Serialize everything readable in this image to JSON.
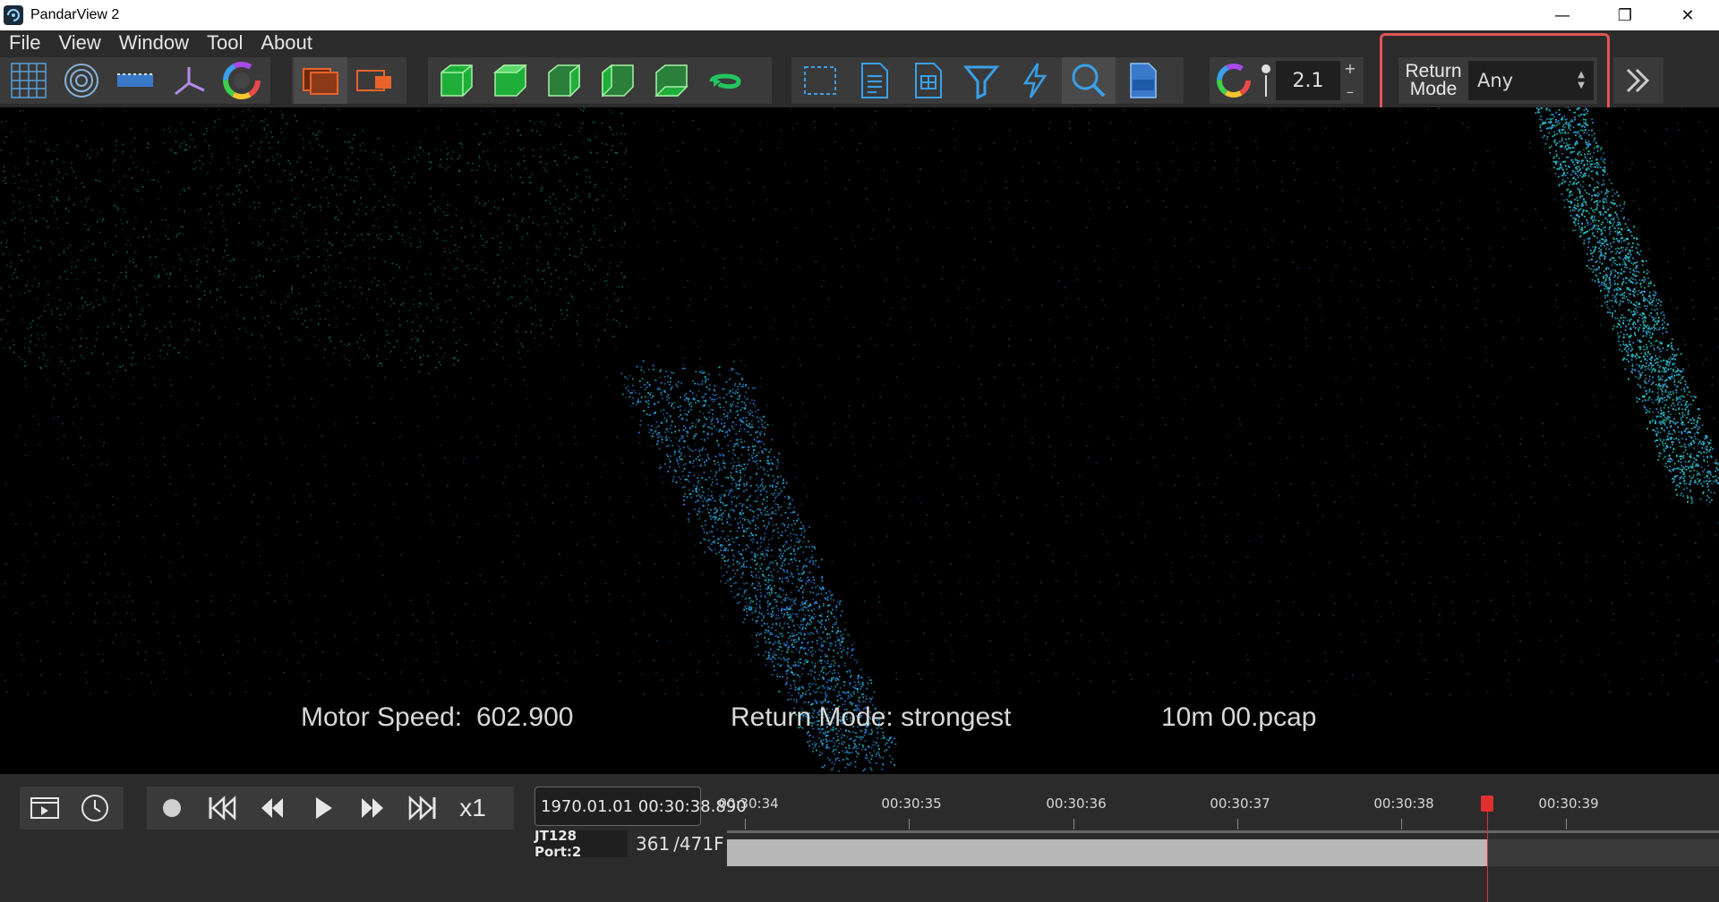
{
  "window": {
    "title": "PandarView 2",
    "minimize": "—",
    "restore": "❐",
    "close": "✕"
  },
  "menu": [
    "File",
    "View",
    "Window",
    "Tool",
    "About"
  ],
  "toolbar": {
    "point_size": {
      "value": "2.1",
      "plus": "+",
      "minus": "–"
    },
    "return_mode": {
      "label_line1": "Return",
      "label_line2": "Mode",
      "value": "Any"
    },
    "more": "more"
  },
  "overlay": {
    "motor_speed_label": "Motor Speed:",
    "motor_speed_value": "602.900",
    "return_mode": "Return Mode: strongest",
    "file_name": "10m 00.pcap"
  },
  "playback": {
    "speed": "x1",
    "timestamp": "1970.01.01 00:30:38.890",
    "device": "JT128 Port:2",
    "frame_current": "361",
    "frame_total": "/471F",
    "progress_fraction": 0.7665,
    "ticks": [
      "00:30:34",
      "00:30:35",
      "00:30:36",
      "00:30:37",
      "00:30:38",
      "00:30:39"
    ]
  },
  "colors": {
    "highlight": "#e05555",
    "green_icon": "#22c55e",
    "blue_icon": "#3aa0e8",
    "playhead": "#e03030"
  }
}
